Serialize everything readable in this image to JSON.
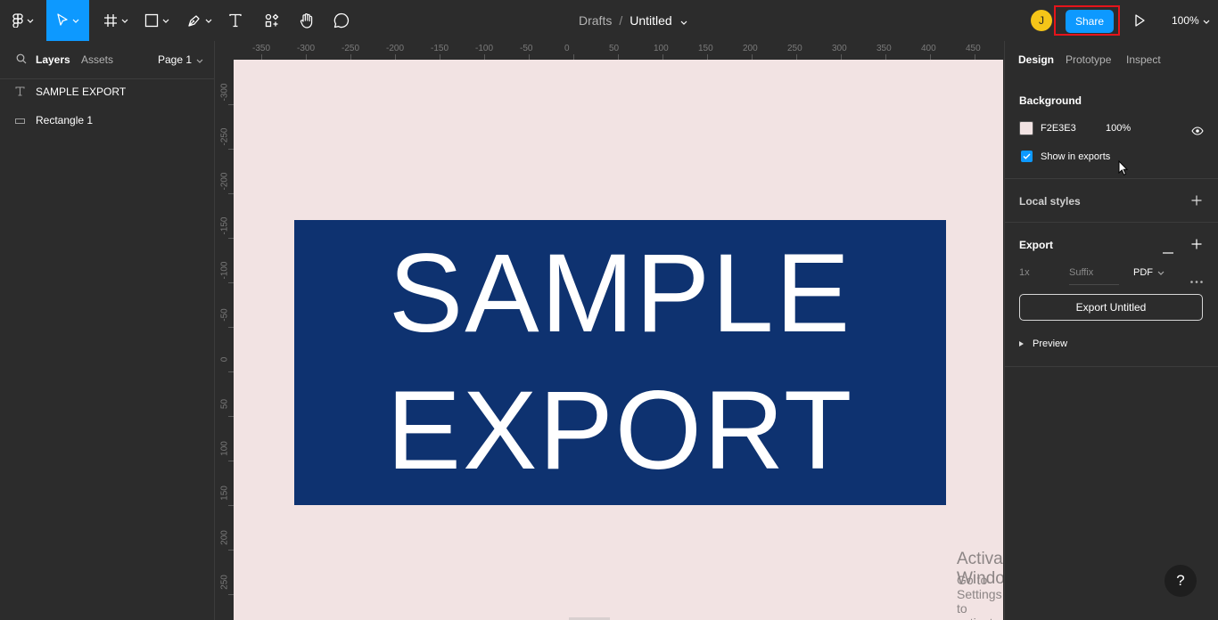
{
  "toolbar": {
    "tools": [
      {
        "name": "main-menu",
        "icon": "figma-logo-icon"
      },
      {
        "name": "move-tool",
        "icon": "cursor-arrow-icon",
        "active": true
      },
      {
        "name": "frame-tool",
        "icon": "hash-frame-icon"
      },
      {
        "name": "shape-tool",
        "icon": "rectangle-icon"
      },
      {
        "name": "pen-tool",
        "icon": "pen-icon"
      },
      {
        "name": "text-tool",
        "icon": "text-t-icon"
      },
      {
        "name": "resources-tool",
        "icon": "components-icon"
      },
      {
        "name": "hand-tool",
        "icon": "hand-icon"
      },
      {
        "name": "comment-tool",
        "icon": "comment-bubble-icon"
      }
    ],
    "breadcrumb": {
      "folder": "Drafts",
      "separator": "/",
      "file": "Untitled"
    },
    "avatar_initial": "J",
    "share_label": "Share",
    "zoom": "100%",
    "accent": "#0d99ff",
    "highlight_color": "#e5141b"
  },
  "left_panel": {
    "tabs": [
      "Layers",
      "Assets"
    ],
    "page": "Page 1",
    "layers": [
      {
        "icon": "text-t-icon",
        "label": "SAMPLE EXPORT"
      },
      {
        "icon": "rectangle-icon",
        "label": "Rectangle 1"
      }
    ]
  },
  "rulers": {
    "top": [
      "-350",
      "-300",
      "-250",
      "-200",
      "-150",
      "-100",
      "-50",
      "0",
      "50",
      "100",
      "150",
      "200",
      "250",
      "300",
      "350",
      "400",
      "450"
    ],
    "left": [
      "-300",
      "-250",
      "-200",
      "-150",
      "-100",
      "-50",
      "0",
      "50",
      "100",
      "150",
      "200",
      "250"
    ]
  },
  "canvas": {
    "background": "#f2e3e3",
    "rect_color": "#0e3270",
    "text_lines": [
      "SAMPLE",
      "EXPORT"
    ],
    "watermark_title": "Activate Windows",
    "watermark_sub": "Go to Settings to activate Windows."
  },
  "right_panel": {
    "tabs": [
      "Design",
      "Prototype",
      "Inspect"
    ],
    "background": {
      "title": "Background",
      "hex": "F2E3E3",
      "opacity": "100%",
      "show_in_exports": "Show in exports"
    },
    "local_styles": "Local styles",
    "export": {
      "title": "Export",
      "scale": "1x",
      "suffix_placeholder": "Suffix",
      "format": "PDF",
      "button": "Export Untitled",
      "preview": "Preview"
    }
  },
  "help_label": "?"
}
